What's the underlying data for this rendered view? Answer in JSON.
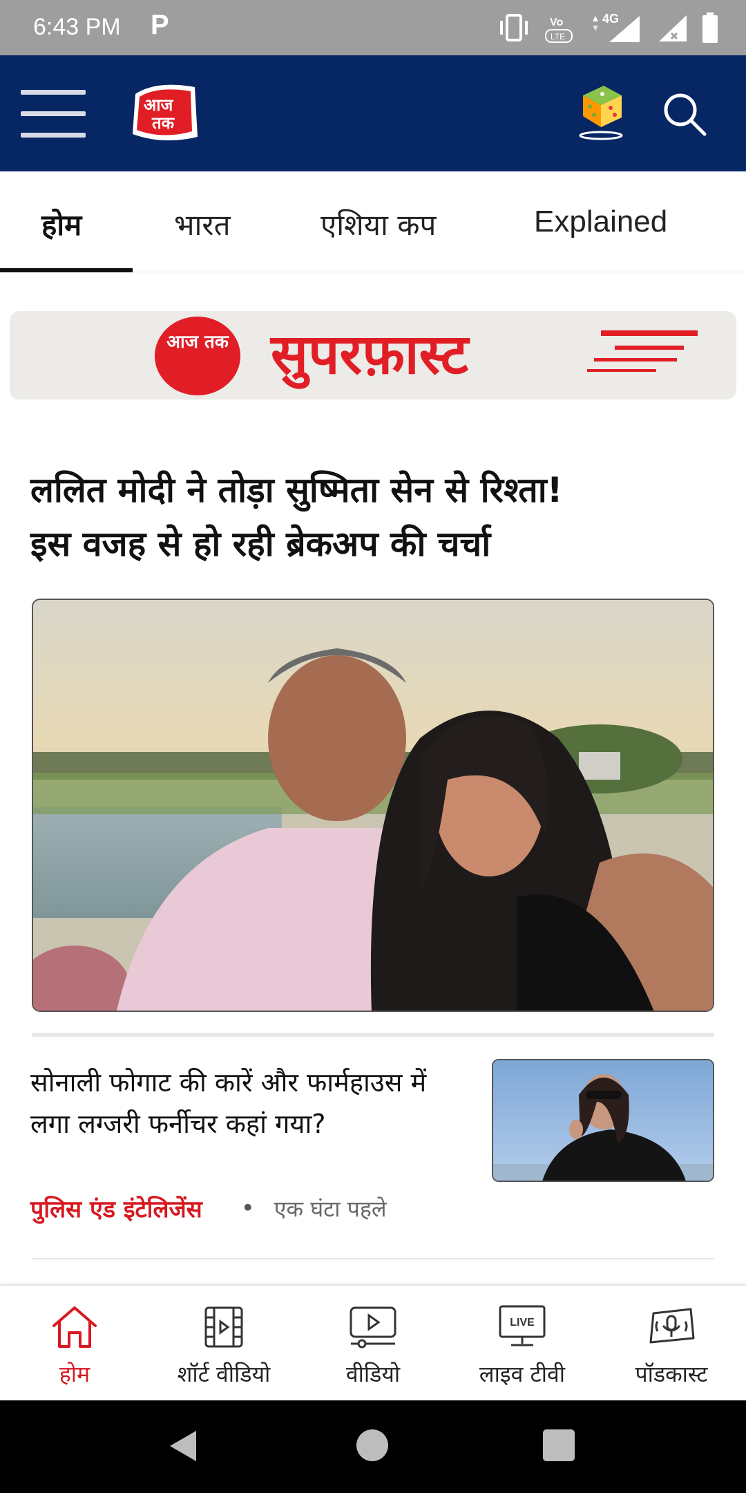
{
  "status_bar": {
    "time": "6:43 PM",
    "app_indicator": "P",
    "network": "4G",
    "volte": "VoLTE"
  },
  "header": {
    "logo_text": "आज तक",
    "icons": [
      "menu-icon",
      "logo",
      "game-dice-icon",
      "search-icon"
    ]
  },
  "tabs": [
    {
      "label": "होम",
      "active": true
    },
    {
      "label": "भारत",
      "active": false
    },
    {
      "label": "एशिया कप",
      "active": false
    },
    {
      "label": "Explained",
      "active": false
    }
  ],
  "banner": {
    "logo_text": "आज तक",
    "title": "सुपरफ़ास्ट",
    "accent": "#e11e26"
  },
  "headline": {
    "line1": "ललित मोदी ने तोड़ा सुष्मिता सेन से रिश्ता!",
    "line2": "इस वजह से हो रही ब्रेकअप की चर्चा"
  },
  "story": {
    "title": "सोनाली फोगाट की कारें और फार्महाउस में लगा लग्जरी फर्नीचर कहां गया?",
    "category": "पुलिस एंड इंटेलिजेंस",
    "time": "एक घंटा पहले"
  },
  "bottom_nav": [
    {
      "label": "होम",
      "icon": "home-icon",
      "active": true
    },
    {
      "label": "शॉर्ट वीडियो",
      "icon": "short-video-icon",
      "active": false
    },
    {
      "label": "वीडियो",
      "icon": "video-icon",
      "active": false
    },
    {
      "label": "लाइव टीवी",
      "icon": "live-tv-icon",
      "live_badge": "LIVE",
      "active": false
    },
    {
      "label": "पॉडकास्ट",
      "icon": "podcast-icon",
      "active": false
    }
  ],
  "colors": {
    "header_bg": "#062664",
    "accent_red": "#d71920",
    "status_bar_bg": "#9e9e9e"
  }
}
